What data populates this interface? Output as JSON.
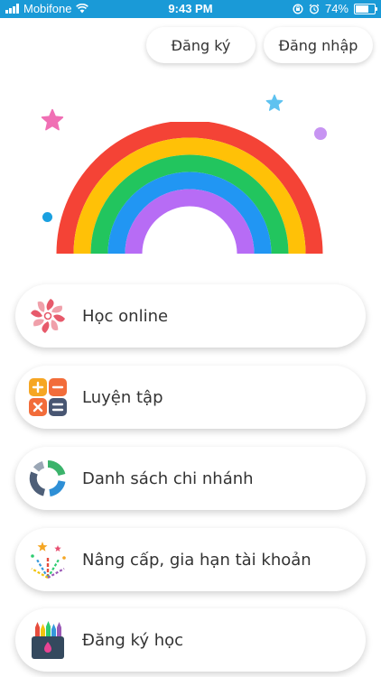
{
  "status_bar": {
    "carrier": "Mobifone",
    "time": "9:43 PM",
    "battery": "74%",
    "battery_level": 0.74,
    "icons": [
      "signal-icon",
      "wifi-icon",
      "rotation-lock-icon",
      "alarm-icon",
      "battery-icon"
    ]
  },
  "header": {
    "register_label": "Đăng ký",
    "login_label": "Đăng nhập"
  },
  "hero": {
    "image": "rainbow-illustration",
    "colors": [
      "#f44336",
      "#ffc107",
      "#22c55e",
      "#2196f3",
      "#b76cf5"
    ],
    "decorations": [
      "pink-star",
      "blue-star",
      "purple-dot",
      "blue-dot"
    ]
  },
  "menu": [
    {
      "label": "Học online",
      "icon": "pinwheel-icon"
    },
    {
      "label": "Luyện tập",
      "icon": "calculator-icon"
    },
    {
      "label": "Danh sách chi nhánh",
      "icon": "branch-circle-icon"
    },
    {
      "label": "Nâng cấp, gia hạn tài khoản",
      "icon": "fireworks-icon"
    },
    {
      "label": "Đăng ký học",
      "icon": "crayons-icon"
    }
  ]
}
